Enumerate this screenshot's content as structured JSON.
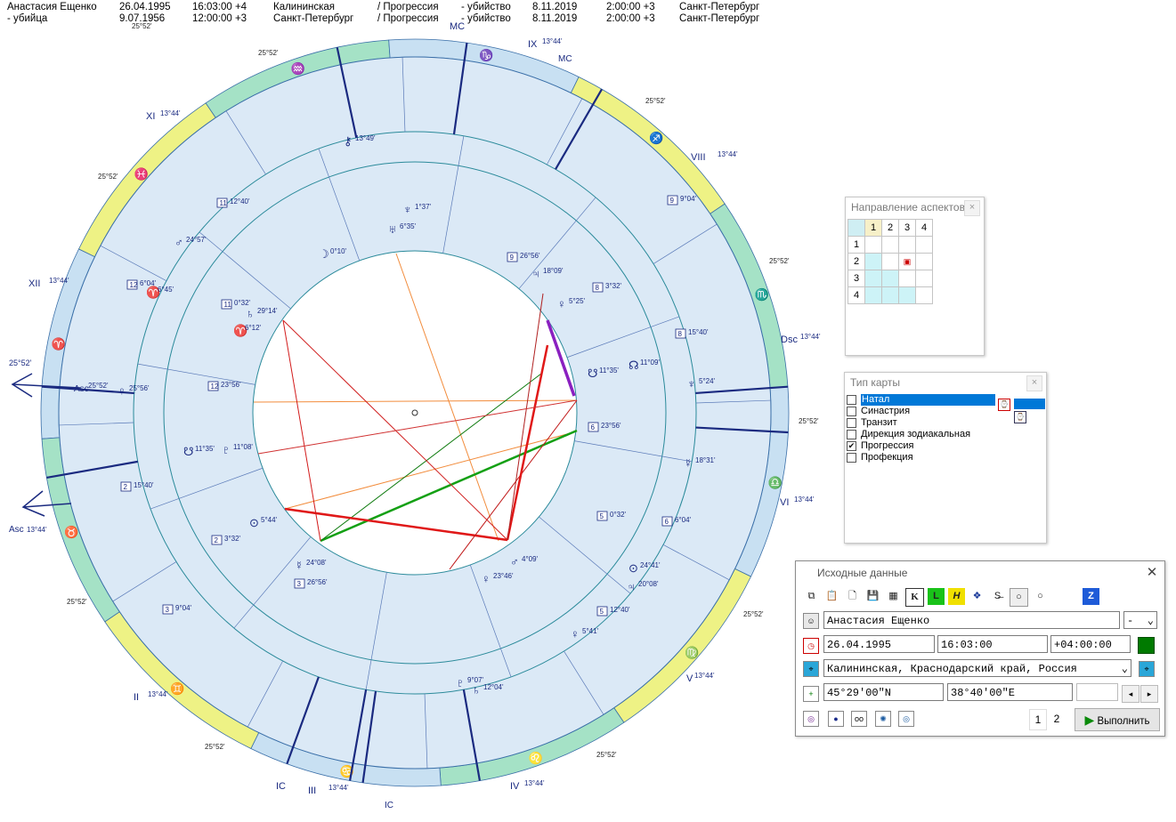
{
  "header": {
    "row1": [
      "Анастасия Ещенко",
      "26.04.1995",
      "16:03:00 +4",
      "Калининская",
      "/ Прогрессия",
      "- убийство",
      "8.11.2019",
      "2:00:00 +3",
      "Санкт-Петербург"
    ],
    "row2": [
      "- убийца",
      "9.07.1956",
      "12:00:00 +3",
      "Санкт-Петербург",
      "/ Прогрессия",
      "- убийство",
      "8.11.2019",
      "2:00:00 +3",
      "Санкт-Петербург"
    ]
  },
  "chart": {
    "asc_outer": "Asc",
    "asc_outer_deg": "25°52'",
    "asc_inner": "Asc",
    "asc_inner_deg": "13°44'",
    "dsc": "Dsc",
    "dsc_deg": "13°44'",
    "mc": "MC",
    "ic": "IC",
    "houses_outer": [
      "XI",
      "XII",
      "II",
      "III",
      "IV",
      "V",
      "VI",
      "VIII",
      "IX"
    ],
    "house_deg": "13°44'",
    "cusp_deg": "25°52'",
    "inner_planets": [
      {
        "sym": "☽",
        "deg": "0°10'"
      },
      {
        "sym": "♅",
        "deg": "6°35'"
      },
      {
        "sym": "♆",
        "deg": "1°37'"
      },
      {
        "sym": "⚷",
        "deg": "13°49'"
      },
      {
        "sym": "♃",
        "deg": "18°09'"
      },
      {
        "sym": "♀",
        "deg": "5°25'"
      },
      {
        "sym": "☋",
        "deg": "11°35'"
      },
      {
        "sym": "☊",
        "deg": "11°09'"
      },
      {
        "sym": "♆",
        "deg": "5°24'"
      },
      {
        "sym": "☿",
        "deg": "18°31'"
      },
      {
        "sym": "♃",
        "deg": "20°08'"
      },
      {
        "sym": "⊙",
        "deg": "24°41'"
      },
      {
        "sym": "♀",
        "deg": "5°41'"
      },
      {
        "sym": "♄",
        "deg": "12°04'"
      },
      {
        "sym": "♇",
        "deg": "9°07'"
      },
      {
        "sym": "♀",
        "deg": "23°46'"
      },
      {
        "sym": "♂",
        "deg": "4°09'"
      },
      {
        "sym": "☿",
        "deg": "24°08'"
      },
      {
        "sym": "⊙",
        "deg": "5°44'"
      },
      {
        "sym": "♇",
        "deg": "11°08'"
      },
      {
        "sym": "☋",
        "deg": "11°35'"
      },
      {
        "sym": "♀",
        "deg": "25°56'"
      },
      {
        "sym": "♂",
        "deg": "24°57'"
      },
      {
        "sym": "♈",
        "deg": "6°45'"
      },
      {
        "sym": "♄",
        "deg": "29°14'"
      },
      {
        "sym": "♈",
        "deg": "6°12'"
      }
    ],
    "house_numbers": [
      {
        "n": "11",
        "deg": "12°40'"
      },
      {
        "n": "12",
        "deg": "6°04'"
      },
      {
        "n": "11",
        "deg": "0°32'"
      },
      {
        "n": "12",
        "deg": "23°56'"
      },
      {
        "n": "2",
        "deg": "15°40'"
      },
      {
        "n": "2",
        "deg": "3°32'"
      },
      {
        "n": "3",
        "deg": "26°56'"
      },
      {
        "n": "3",
        "deg": "9°04'"
      },
      {
        "n": "5",
        "deg": "12°40'"
      },
      {
        "n": "5",
        "deg": "0°32'"
      },
      {
        "n": "6",
        "deg": "6°04'"
      },
      {
        "n": "6",
        "deg": "23°56'"
      },
      {
        "n": "8",
        "deg": "15°40'"
      },
      {
        "n": "8",
        "deg": "3°32'"
      },
      {
        "n": "9",
        "deg": "26°56'"
      },
      {
        "n": "9",
        "deg": "9°04'"
      }
    ]
  },
  "aspect_panel": {
    "title": "Направление аспектов",
    "cols": [
      "1",
      "2",
      "3",
      "4"
    ],
    "rows": [
      "1",
      "2",
      "3",
      "4"
    ]
  },
  "chart_type_panel": {
    "title": "Тип карты",
    "items": [
      {
        "label": "Натал",
        "checked": false,
        "selected": true
      },
      {
        "label": "Синастрия",
        "checked": false,
        "selected": false
      },
      {
        "label": "Транзит",
        "checked": false,
        "selected": false
      },
      {
        "label": "Дирекция зодиакальная",
        "checked": false,
        "selected": false
      },
      {
        "label": "Прогрессия",
        "checked": true,
        "selected": false
      },
      {
        "label": "Профекция",
        "checked": false,
        "selected": false
      }
    ]
  },
  "input_panel": {
    "title": "Исходные данные",
    "name": "Анастасия Ещенко",
    "gender": "-",
    "date": "26.04.1995",
    "time": "16:03:00",
    "tz": "+04:00:00",
    "place": "Калининская, Краснодарский край, Россия",
    "lat": "45°29'00\"N",
    "lon": "38°40'00\"E",
    "page1": "1",
    "page2": "2",
    "run": "Выполнить",
    "accent": "#007a00"
  }
}
